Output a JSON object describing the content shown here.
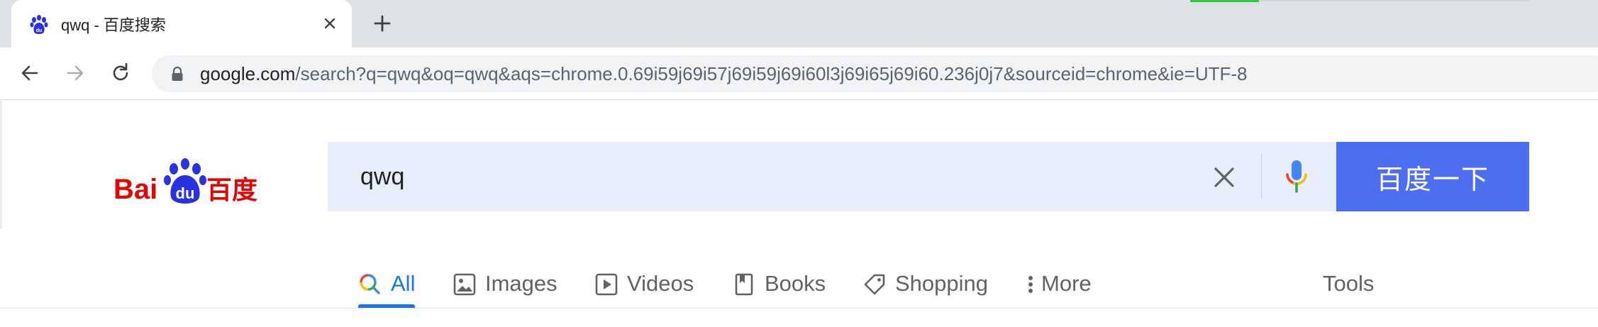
{
  "browser": {
    "tab": {
      "title": "qwq - 百度搜索",
      "favicon": "baidu-paw-icon"
    },
    "toolbar": {
      "url_host": "google.com",
      "url_path": "/search?q=qwq&oq=qwq&aqs=chrome.0.69i59j69i57j69i59j69i60l3j69i65j69i60.236j0j7&sourceid=chrome&ie=UTF-8"
    }
  },
  "search": {
    "query": "qwq",
    "submit_label": "百度一下"
  },
  "logo": {
    "text_left": "Bai",
    "text_badge": "du",
    "text_right": "百度"
  },
  "nav_tabs": [
    {
      "label": "All",
      "icon": "search-icon",
      "active": true
    },
    {
      "label": "Images",
      "icon": "image-icon",
      "active": false
    },
    {
      "label": "Videos",
      "icon": "video-icon",
      "active": false
    },
    {
      "label": "Books",
      "icon": "book-icon",
      "active": false
    },
    {
      "label": "Shopping",
      "icon": "tag-icon",
      "active": false
    },
    {
      "label": "More",
      "icon": "more-vert-icon",
      "active": false
    }
  ],
  "tools_label": "Tools",
  "colors": {
    "baidu_blue": "#4e6ef2",
    "baidu_red": "#e10602",
    "baidu_paw_blue": "#2932e1",
    "google_active_blue": "#1a73e8",
    "search_box_bg": "#e8eefb"
  }
}
